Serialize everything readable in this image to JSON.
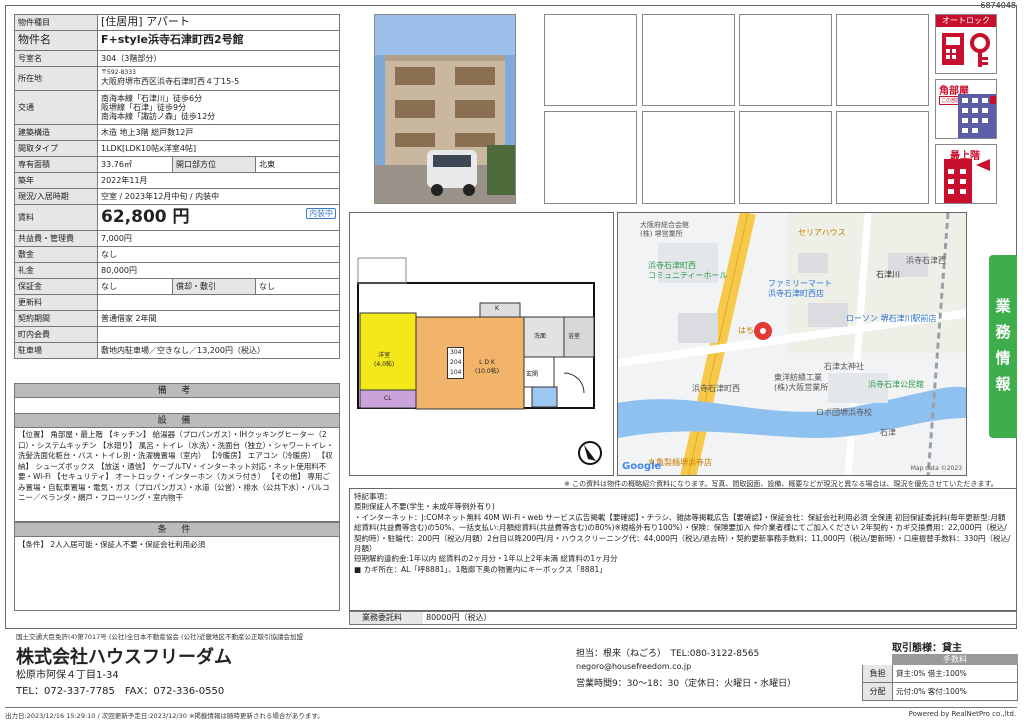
{
  "ref_no": "6874048",
  "spec": {
    "type_k": "物件種目",
    "type_v": "[住居用] アパート",
    "name_k": "物件名",
    "name_v": "F+style浜寺石津町西2号館",
    "room_k": "号室名",
    "room_v": "304（3階部分）",
    "addr_k": "所在地",
    "addr_zip": "〒592-8333",
    "addr_v": "大阪府堺市西区浜寺石津町西４丁15-5",
    "traffic_k": "交通",
    "traffic": [
      "南海本線「石津川」徒歩6分",
      "阪堺線「石津」徒歩9分",
      "南海本線「諏訪ノ森」徒歩12分"
    ],
    "struct_k": "建築構造",
    "struct_v": "木造 地上3階 総戸数12戸",
    "layout_k": "間取タイプ",
    "layout_v": "1LDK[LDK10帖x洋室4帖]",
    "area_k": "専有面積",
    "area_v": "33.76㎡",
    "dir_k": "開口部方位",
    "dir_v": "北東",
    "built_k": "築年",
    "built_v": "2022年11月",
    "status_k": "現況/入居時期",
    "status_v": "空室 / 2023年12月中旬 / 内装中",
    "rent_k": "賃料",
    "rent_v": "62,800 円",
    "rent_badge": "内装中",
    "fee_k": "共益費・管理費",
    "fee_v": "7,000円",
    "deposit_k": "敷金",
    "deposit_v": "なし",
    "key_k": "礼金",
    "key_v": "80,000円",
    "guar_k": "保証金",
    "guar_v": "なし",
    "amort_k": "償却・敷引",
    "amort_v": "なし",
    "renew_k": "更新料",
    "renew_v": "",
    "contract_k": "契約期間",
    "contract_v": "普通借家 2年間",
    "assoc_k": "町内会費",
    "assoc_v": "",
    "parking_k": "駐車場",
    "parking_v": "敷地内駐車場／空きなし／13,200円（税込）"
  },
  "remarks_title": "備 考",
  "facilities_title": "設 備",
  "facilities_text": "【位置】 角部屋・最上階 【キッチン】 給湯器（プロパンガス）・IHクッキングヒーター（2口）・システムキッチン 【水廻り】 風呂・トイレ（水洗）・洗面台（独立）・シャワートイレ・洗髪洗面化粧台・バス・トイレ別・洗濯機置場（室内） 【冷暖房】 エアコン（冷暖房） 【収納】 シューズボックス 【放送・通信】 ケーブルTV・インターネット対応・ネット使用料不要・Wi-Fi 【セキュリティ】 オートロック・インターホン（カメラ付き） 【その他】 専用ごみ置場・自転車置場・電気・ガス（プロパンガス）・水道（公営）・排水（公共下水）・バルコニー／ベランダ・網戸・フローリング・室内物干",
  "conditions_title": "条 件",
  "conditions_text": "【条件】 2人入居可能・保証人不要・保証会社利用必須",
  "side_tab": [
    "業",
    "務",
    "情",
    "報"
  ],
  "icons": {
    "autolock": "オートロック",
    "corner": "角部屋",
    "corner_sub": "この部屋!",
    "top": "最上階"
  },
  "floor": {
    "r1": "304",
    "r2": "204",
    "r3": "104",
    "ldk": "L D K",
    "ldk_sub": "(10.0帖)",
    "yoshitsu": "洋室",
    "yoshitsu_sub": "(4.0帖)",
    "cl": "CL",
    "genkan": "玄関",
    "kit": "K",
    "bath": "浴室",
    "wash": "洗面"
  },
  "map": {
    "labels": [
      "大阪府総合会館",
      "(株) 堺営業所",
      "セリアハウス",
      "浜寺石津西",
      "浜寺石津町西",
      "コミュニティーホール",
      "ファミリーマート",
      "浜寺石津町西店",
      "石津川",
      "ローソン 堺石津川駅前店",
      "はち",
      "石津太神社",
      "東洋紡績工業",
      "(株)大阪営業所",
      "浜寺石津町西",
      "浜寺石津公民館",
      "ロボ団堺浜寺校",
      "石津",
      "丸亀製麺堺浜寺店"
    ],
    "google": "Google",
    "copy": "Map data ©2023"
  },
  "note_text": "※ この資料は物件の概略紹介資料になります。写真、間取図面、設備、概要などが現況と異なる場合は、現況を優先させていただきます。",
  "special_title": "特記事項：",
  "special_lines": [
    "原則保証人不要(学生・未成年等例外有り)",
    "・インターネット：J:COMネット無料 40M Wi-Fi・web サービス広告掲載【要確認】・チラシ、雑誌等掲載広告【要確認】・保証会社：保証会社利用必須 全保連 初回保証委託料(毎年更新型:月額総賃料(共益費等含む)の50%、一括支払い:月額総賃料(共益費等含む)の80%)※規格外有り100%）・保険：保険要加入 仲介業者様にてご加入ください 2年契約・カギ交換費用：22,000円（税込/契約時）・駐輪代：200円（税込/月額）2台目以降200円/月・ハウスクリーニング代：44,000円（税込/退去時）・契約更新事務手数料：11,000円（税込/更新時）・口座振替手数料：330円（税込/月額）",
    "短期解約違約金:1年以内 総賃料の2ヶ月分・1年以上2年未満 総賃料の1ヶ月分",
    "■ カギ所在：AL「呼8881」、1階廊下奥の物置内にキーボックス「8881」"
  ],
  "commission_k": "業務委託料",
  "commission_v": "80000円（税込）",
  "company": {
    "license": "国土交通大臣免許(4)第7017号 (公社)全日本不動産協会 (公社)近畿地区不動産公正取引協議会加盟",
    "name": "株式会社ハウスフリーダム",
    "addr": "松原市阿保４丁目1-34",
    "tel": "TEL：072-337-7785　FAX：072-336-0550",
    "contact": "担当：根来（ねごろ）　TEL:080-3122-8565",
    "email": "negoro@housefreedom.co.jp",
    "hours": "営業時間9：30～18：30（定休日：火曜日・水曜日）"
  },
  "deal": {
    "title": "取引態様：貸主",
    "fee_h": "手数料",
    "r1k": "負担",
    "r1v": "貸主:0% 借主:100%",
    "r2k": "分配",
    "r2v": "元付:0% 客付:100%"
  },
  "footer": {
    "left": "出力日:2023/12/16 15:29:10 / 次回更新予定日:2023/12/30 ※掲載情報は随時更新される場合があります。",
    "right": "Powered by RealNetPro co.,ltd."
  }
}
